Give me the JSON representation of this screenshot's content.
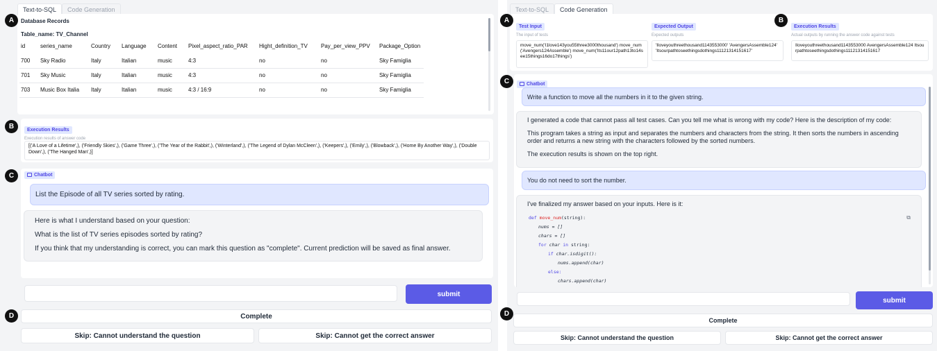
{
  "left": {
    "tabs": [
      "Text-to-SQL",
      "Code Generation"
    ],
    "markers": {
      "a": "A",
      "b": "B",
      "c": "C",
      "d": "D"
    },
    "db": {
      "title": "Database Records",
      "table_name": "Table_name: TV_Channel",
      "columns": [
        "id",
        "series_name",
        "Country",
        "Language",
        "Content",
        "Pixel_aspect_ratio_PAR",
        "Hight_definition_TV",
        "Pay_per_view_PPV",
        "Package_Option"
      ],
      "rows": [
        [
          "700",
          "Sky Radio",
          "Italy",
          "Italian",
          "music",
          "4:3",
          "no",
          "no",
          "Sky Famiglia"
        ],
        [
          "701",
          "Sky Music",
          "Italy",
          "Italian",
          "music",
          "4:3",
          "no",
          "no",
          "Sky Famiglia"
        ],
        [
          "703",
          "Music Box Italia",
          "Italy",
          "Italian",
          "music",
          "4:3 / 16:9",
          "no",
          "no",
          "Sky Famiglia"
        ]
      ]
    },
    "exec": {
      "label": "Execution Results",
      "sublabel": "Execution results of answer code",
      "text": "[('A Love of a Lifetime',), ('Friendly Skies',), ('Game Three',), ('The Year of the Rabbit',), ('Winterland',), ('The Legend of Dylan McCleen',), ('Keepers',), ('Emily',), ('Blowback',), ('Home By Another Way',), ('Double Down',), ('The Hanged Man',)]"
    },
    "chat": {
      "label": "Chatbot",
      "user": "List the Episode of all TV series sorted by rating.",
      "bot": [
        "Here is what I understand based on your question:",
        "What is the list of TV series episodes sorted by rating?",
        "If you think that my understanding is correct, you can mark this question as \"complete\". Current prediction will be saved as final answer."
      ]
    },
    "input_value": "",
    "submit": "submit",
    "complete": "Complete",
    "skip1": "Skip: Cannot understand the question",
    "skip2": "Skip: Cannot get the correct answer"
  },
  "right": {
    "tabs": [
      "Text-to-SQL",
      "Code Generation"
    ],
    "markers": {
      "a": "A",
      "b": "B",
      "c": "C",
      "d": "D"
    },
    "test_input": {
      "label": "Test Input",
      "sublabel": "The input of tests",
      "text": "move_num('I1love143you55three3000thousand') move_num('Avengers124Assemble') move_num('Its11our12path13to14see15things16do17things')"
    },
    "expected": {
      "label": "Expected Output",
      "sublabel": "Expected outputs",
      "text": "'Iloveyouthreethousand1143553000' 'AvengersAssemble124' 'Itsourpathtoseethingsdothings11121314151617'"
    },
    "exec": {
      "label": "Execution Results",
      "sublabel": "Actual outputs by running the answer code against tests",
      "text": "Iloveyouthreethousand1143553000 AvengersAssemble124 Itsourpathtoseethingsdothings11121314151617"
    },
    "chat": {
      "label": "Chatbot",
      "user1": "Write a function to move all the numbers in it to the given string.",
      "bot1": [
        "I generated a code that cannot pass all test cases. Can you tell me what is wrong with my code? Here is the description of my code:",
        "This program takes a string as input and separates the numbers and characters from the string. It then sorts the numbers in ascending order and returns a new string with the characters followed by the sorted numbers.",
        "The execution results is shown on the top right."
      ],
      "user2": "You do not need to sort the number.",
      "bot2": "I've finalized my answer based on your inputs. Here is it:",
      "code": {
        "l1_kw": "def",
        "l1_fn": "move_num",
        "l1_rest": "(string):",
        "l2": "nums = []",
        "l3": "chars = []",
        "l4_kw": "for",
        "l4_v": "char",
        "l4_kw2": "in",
        "l4_rest": "string:",
        "l5_kw": "if",
        "l5_rest": "char.isdigit():",
        "l6": "nums.append(char)",
        "l7_kw": "else:",
        "l8": "chars.append(char)"
      }
    },
    "input_value": "",
    "submit": "submit",
    "complete": "Complete",
    "skip1": "Skip: Cannot understand the question",
    "skip2": "Skip: Cannot get the correct answer",
    "icons": {
      "copy": "copy-icon",
      "status": "status-dot-icon"
    },
    "colors": {
      "accent": "#5b5be6",
      "badge_bg": "#e0e7ff",
      "user_bubble": "#e0e7ff",
      "status_dot": "#16a34a"
    }
  }
}
